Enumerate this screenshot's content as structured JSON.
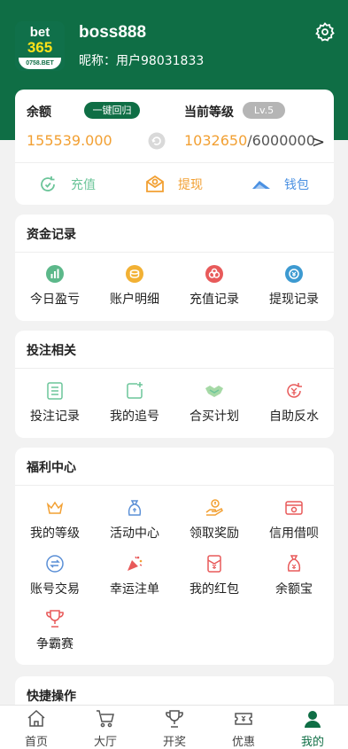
{
  "profile": {
    "logo_text_top": "bet",
    "logo_text_number": "365",
    "logo_site": "0758.BET",
    "username": "boss888",
    "nickname": "昵称：用户98031833"
  },
  "balance": {
    "label": "余额",
    "one_key_return": "一键回归",
    "amount": "155539.000",
    "level_label": "当前等级",
    "level_badge": "Lv.5",
    "exp_current": "1032650",
    "exp_slash": "/",
    "exp_max": "6000000",
    "arrow": ">",
    "actions": [
      {
        "label": "充值",
        "icon": "recharge-icon",
        "color": "#6cc59a"
      },
      {
        "label": "提现",
        "icon": "withdraw-icon",
        "color": "#f2a033"
      },
      {
        "label": "钱包",
        "icon": "wallet-icon",
        "color": "#4a90e2"
      }
    ]
  },
  "funds": {
    "title": "资金记录",
    "items": [
      {
        "label": "今日盈亏",
        "icon": "chart-icon",
        "color": "#5cb88a"
      },
      {
        "label": "账户明细",
        "icon": "coins-icon",
        "color": "#f2b134"
      },
      {
        "label": "充值记录",
        "icon": "records-icon",
        "color": "#e85a5a"
      },
      {
        "label": "提现记录",
        "icon": "withdraw-record-icon",
        "color": "#3d9ad1"
      }
    ]
  },
  "betting": {
    "title": "投注相关",
    "items": [
      {
        "label": "投注记录",
        "icon": "list-icon",
        "color": "#6cc59a"
      },
      {
        "label": "我的追号",
        "icon": "chase-icon",
        "color": "#6cc59a"
      },
      {
        "label": "合买计划",
        "icon": "handshake-icon",
        "color": "#8bc98b"
      },
      {
        "label": "自助反水",
        "icon": "rebate-icon",
        "color": "#e85a5a"
      }
    ]
  },
  "welfare": {
    "title": "福利中心",
    "items": [
      {
        "label": "我的等级",
        "icon": "crown-icon",
        "color": "#f2a033"
      },
      {
        "label": "活动中心",
        "icon": "gift-bag-icon",
        "color": "#5a8fd6"
      },
      {
        "label": "领取奖励",
        "icon": "reward-icon",
        "color": "#f2a033"
      },
      {
        "label": "信用借呗",
        "icon": "credit-card-icon",
        "color": "#e85a5a"
      },
      {
        "label": "账号交易",
        "icon": "exchange-icon",
        "color": "#5a8fd6"
      },
      {
        "label": "幸运注单",
        "icon": "party-popper-icon",
        "color": "#e85a5a"
      },
      {
        "label": "我的红包",
        "icon": "red-envelope-icon",
        "color": "#e85a5a"
      },
      {
        "label": "余额宝",
        "icon": "money-bag-icon",
        "color": "#e85a5a"
      },
      {
        "label": "争霸赛",
        "icon": "trophy-icon",
        "color": "#e85a5a"
      }
    ]
  },
  "quick": {
    "title": "快捷操作"
  },
  "tabbar": [
    {
      "label": "首页",
      "icon": "home-icon"
    },
    {
      "label": "大厅",
      "icon": "cart-icon"
    },
    {
      "label": "开奖",
      "icon": "trophy-icon"
    },
    {
      "label": "优惠",
      "icon": "ticket-icon"
    },
    {
      "label": "我的",
      "icon": "person-icon",
      "active": true
    }
  ],
  "colors": {
    "primary": "#0f6e45",
    "amount": "#f2a033"
  }
}
